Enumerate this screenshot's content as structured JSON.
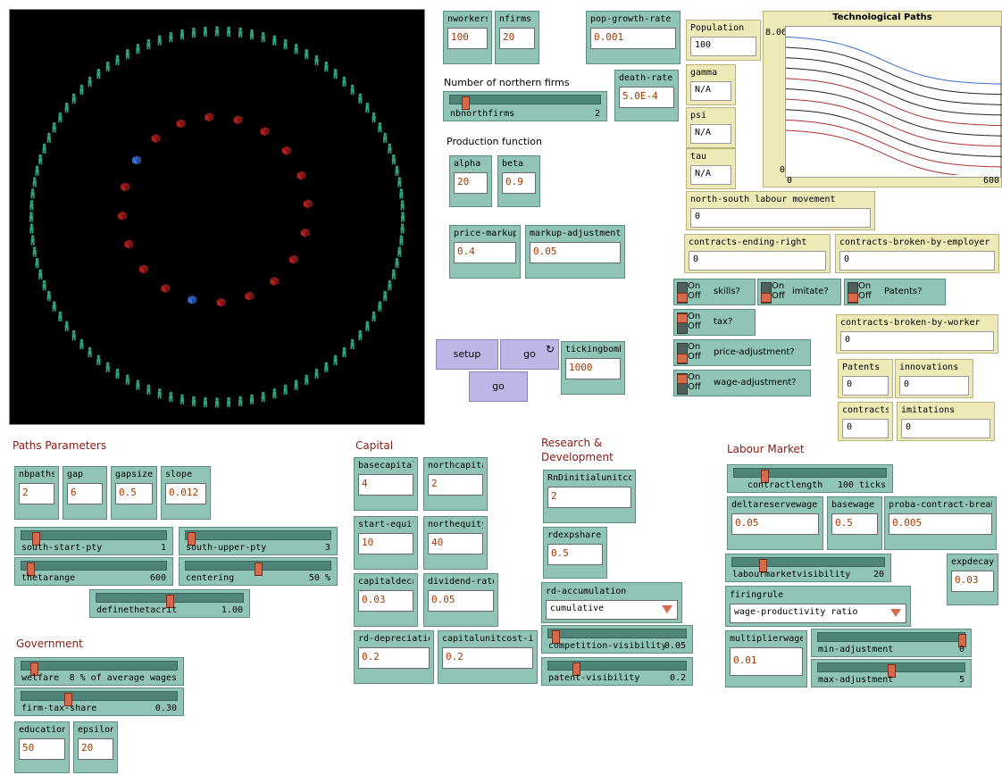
{
  "inputs": {
    "nworkers": {
      "label": "nworkers",
      "value": "100"
    },
    "nfirms": {
      "label": "nfirms",
      "value": "20"
    },
    "pop_growth_rate": {
      "label": "pop-growth-rate",
      "value": "0.001"
    },
    "death_rate": {
      "label": "death-rate",
      "value": "5.0E-4"
    },
    "alpha": {
      "label": "alpha",
      "value": "20"
    },
    "beta": {
      "label": "beta",
      "value": "0.9"
    },
    "price_markup": {
      "label": "price-markup",
      "value": "0.4"
    },
    "markup_adjustment": {
      "label": "markup-adjustment",
      "value": "0.05"
    },
    "tickingbomb": {
      "label": "tickingbomb",
      "value": "1000"
    },
    "nbpaths": {
      "label": "nbpaths",
      "value": "2"
    },
    "gap": {
      "label": "gap",
      "value": "6"
    },
    "gapsize": {
      "label": "gapsize",
      "value": "0.5"
    },
    "slope": {
      "label": "slope",
      "value": "0.012"
    },
    "education": {
      "label": "education",
      "value": "50"
    },
    "epsilon": {
      "label": "epsilon",
      "value": "20"
    },
    "basecapital": {
      "label": "basecapital",
      "value": "4"
    },
    "northcapital": {
      "label": "northcapital",
      "value": "2"
    },
    "start_equity": {
      "label": "start-equity",
      "value": "10"
    },
    "northequity": {
      "label": "northequity",
      "value": "40"
    },
    "capitaldecay": {
      "label": "capitaldecay",
      "value": "0.03"
    },
    "dividend_rate": {
      "label": "dividend-rate",
      "value": "0.05"
    },
    "rd_depreciation": {
      "label": "rd-depreciation",
      "value": "0.2"
    },
    "capitalunitcost_init": {
      "label": "capitalunitcost-init",
      "value": "0.2"
    },
    "rndinitialunitcost": {
      "label": "RnDinitialunitcost",
      "value": "2"
    },
    "rdexpshare": {
      "label": "rdexpshare",
      "value": "0.5"
    },
    "deltareservewage": {
      "label": "deltareservewage",
      "value": "0.05"
    },
    "basewage": {
      "label": "basewage",
      "value": "0.5"
    },
    "proba_contract_break": {
      "label": "proba-contract-break",
      "value": "0.005"
    },
    "expdecay": {
      "label": "expdecay",
      "value": "0.03"
    },
    "multiplierwage": {
      "label": "multiplierwage",
      "value": "0.01"
    }
  },
  "monitors": {
    "population": {
      "label": "Population",
      "value": "100"
    },
    "gamma": {
      "label": "gamma",
      "value": "N/A"
    },
    "psi": {
      "label": "psi",
      "value": "N/A"
    },
    "tau": {
      "label": "tau",
      "value": "N/A"
    },
    "ns_labour": {
      "label": "north-south labour movement",
      "value": "0"
    },
    "contracts_ending_right": {
      "label": "contracts-ending-right",
      "value": "0"
    },
    "contracts_broken_employer": {
      "label": "contracts-broken-by-employer",
      "value": "0"
    },
    "contracts_broken_worker": {
      "label": "contracts-broken-by-worker",
      "value": "0"
    },
    "patents": {
      "label": "Patents",
      "value": "0"
    },
    "innovations": {
      "label": "innovations",
      "value": "0"
    },
    "contracts": {
      "label": "contracts",
      "value": "0"
    },
    "imitations": {
      "label": "imitations",
      "value": "0"
    }
  },
  "sliders": {
    "nbnorthfirms": {
      "name": "nbnorthfirms",
      "value": "2",
      "pos": 0.1
    },
    "south_start_pty": {
      "name": "south-start-pty",
      "value": "1",
      "pos": 0.1
    },
    "south_upper_pty": {
      "name": "south-upper-pty",
      "value": "3",
      "pos": 0.04
    },
    "thetarange": {
      "name": "thetarange",
      "value": "600",
      "pos": 0.06
    },
    "centering": {
      "name": "centering",
      "value": "50 %",
      "pos": 0.5
    },
    "definethetacrit": {
      "name": "definethetacrit",
      "value": "1.00",
      "pos": 0.5
    },
    "welfare": {
      "name": "welfare",
      "value": "8 % of average wages",
      "pos": 0.08
    },
    "firm_tax_share": {
      "name": "firm-tax-share",
      "value": "0.30",
      "pos": 0.3
    },
    "competition_visibility": {
      "name": "competition-visibility",
      "value": "0.05",
      "pos": 0.05
    },
    "patent_visibility": {
      "name": "patent-visibility",
      "value": "0.2",
      "pos": 0.2
    },
    "contractlength": {
      "name": "contractlength",
      "value": "100 ticks",
      "pos": 0.2
    },
    "labourmarketvisibility": {
      "name": "labourmarketvisibility",
      "value": "20",
      "pos": 0.2
    },
    "min_adjustment": {
      "name": "min-adjustment",
      "value": "0",
      "pos": 0.98
    },
    "max_adjustment": {
      "name": "max-adjustment",
      "value": "5",
      "pos": 0.5
    }
  },
  "switches": {
    "on_label": "On",
    "off_label": "Off",
    "skills": {
      "label": "skills?",
      "state": "off"
    },
    "imitate": {
      "label": "imitate?",
      "state": "off"
    },
    "patents": {
      "label": "Patents?",
      "state": "off"
    },
    "tax": {
      "label": "tax?",
      "state": "on"
    },
    "price_adjustment": {
      "label": "price-adjustment?",
      "state": "off"
    },
    "wage_adjustment": {
      "label": "wage-adjustment?",
      "state": "on"
    }
  },
  "choosers": {
    "rd_accumulation": {
      "label": "rd-accumulation",
      "value": "cumulative"
    },
    "firingrule": {
      "label": "firingrule",
      "value": "wage-productivity ratio"
    }
  },
  "buttons": {
    "setup": "setup",
    "go_forever": "go",
    "go_once": "go"
  },
  "notes": {
    "northern_firms": "Number of northern firms",
    "production_function": "Production function"
  },
  "sections": {
    "paths": "Paths Parameters",
    "government": "Government",
    "capital": "Capital",
    "research": "Research & Development",
    "labour": "Labour Market"
  },
  "plot": {
    "title": "Technological Paths",
    "ymax": "8.06",
    "ymin": "0",
    "xmin": "0",
    "xmax": "600"
  },
  "colors": {
    "widget": "#8fc4b7",
    "monitor": "#eeeab8",
    "button": "#bdb7e6",
    "section_title": "#8a1a12",
    "workers": "#2ea37a",
    "firms_south": "#b0201e",
    "firms_north": "#3a6fd8"
  },
  "world": {
    "workers": 100,
    "firms": 20,
    "north_firms": 2
  }
}
